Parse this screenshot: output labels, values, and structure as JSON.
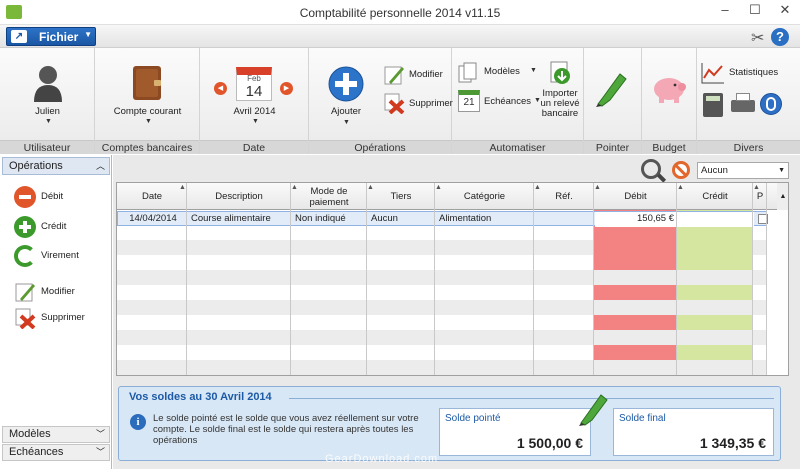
{
  "window": {
    "title": "Comptabilité personnelle 2014 v11.15",
    "minimize": "–",
    "maximize": "☐",
    "close": "✕"
  },
  "toolbar": {
    "fichier_label": "Fichier"
  },
  "ribbon": {
    "utilisateur": {
      "name": "Julien",
      "group_label": "Utilisateur"
    },
    "comptes": {
      "account": "Compte courant",
      "group_label": "Comptes bancaires"
    },
    "date": {
      "month_abbr": "Feb",
      "day": "14",
      "value": "Avril 2014",
      "group_label": "Date"
    },
    "operations": {
      "ajouter": "Ajouter",
      "modifier": "Modifier",
      "supprimer": "Supprimer",
      "group_label": "Opérations"
    },
    "automatiser": {
      "modeles": "Modèles",
      "echeances": "Echéances",
      "calendar_day": "21",
      "importer": "Importer un relevé bancaire",
      "group_label": "Automatiser"
    },
    "pointer": {
      "group_label": "Pointer"
    },
    "budget": {
      "group_label": "Budget"
    },
    "divers": {
      "statistiques": "Statistiques",
      "group_label": "Divers"
    }
  },
  "sidebar": {
    "header": "Opérations",
    "items": [
      {
        "label": "Débit",
        "icon": "minus-circle-icon",
        "color": "#e0552a"
      },
      {
        "label": "Crédit",
        "icon": "plus-circle-icon",
        "color": "#3c9a2c"
      },
      {
        "label": "Virement",
        "icon": "refresh-icon",
        "color": "#3c9a2c"
      },
      {
        "label": "Modifier",
        "icon": "pencil-icon",
        "color": "#5a9a30"
      },
      {
        "label": "Supprimer",
        "icon": "delete-x-icon",
        "color": "#d23a20"
      }
    ],
    "bottom": [
      "Modèles",
      "Echéances"
    ]
  },
  "filter": {
    "value": "Aucun"
  },
  "table": {
    "columns": [
      "Date",
      "Description",
      "Mode de paiement",
      "Tiers",
      "Catégorie",
      "Réf.",
      "Débit",
      "Crédit",
      "P"
    ],
    "rows": [
      {
        "date": "14/04/2014",
        "description": "Course alimentaire",
        "mode": "Non indiqué",
        "tiers": "Aucun",
        "categorie": "Alimentation",
        "ref": "",
        "debit": "150,65 €",
        "credit": "",
        "pointed": false
      }
    ]
  },
  "soldes": {
    "title": "Vos soldes au 30 Avril 2014",
    "info": "Le solde pointé est le solde que vous avez réellement sur votre compte. Le solde final est le solde qui restera après toutes les opérations",
    "pointe_label": "Solde pointé",
    "pointe_value": "1 500,00 €",
    "final_label": "Solde final",
    "final_value": "1 349,35 €"
  },
  "watermark": "GearDownload.com",
  "colors": {
    "debit_column": "#f38282",
    "credit_column": "#d5e6a0",
    "accent": "#1a57a4"
  }
}
